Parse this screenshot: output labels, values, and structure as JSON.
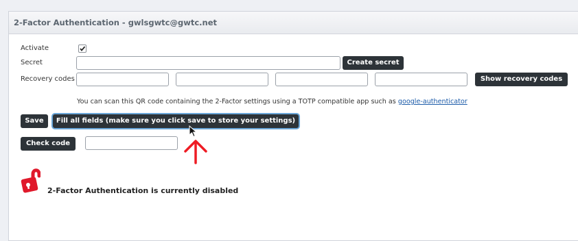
{
  "header": {
    "title": "2-Factor Authentication - gwlsgwtc@gwtc.net"
  },
  "form": {
    "activate_label": "Activate",
    "activate_checked": true,
    "secret_label": "Secret",
    "secret_value": "",
    "create_secret_button": "Create secret",
    "recovery_label": "Recovery codes",
    "recovery_values": [
      "",
      "",
      "",
      ""
    ],
    "show_recovery_button": "Show recovery codes"
  },
  "info": {
    "text": "You can scan this QR code containing the 2-Factor settings using a TOTP compatible app such as",
    "link": "google-authenticator"
  },
  "actions": {
    "save_button": "Save",
    "fill_button": "Fill all fields (make sure you click save to store your settings)",
    "check_code_button": "Check code",
    "check_code_value": ""
  },
  "status": {
    "text": "2-Factor Authentication is currently disabled",
    "icon": "unlocked-padlock-icon",
    "icon_color": "#e0192b"
  },
  "colors": {
    "button_bg": "#2d3338",
    "link": "#1a5aa8",
    "annotation_arrow": "#ee1c24"
  }
}
